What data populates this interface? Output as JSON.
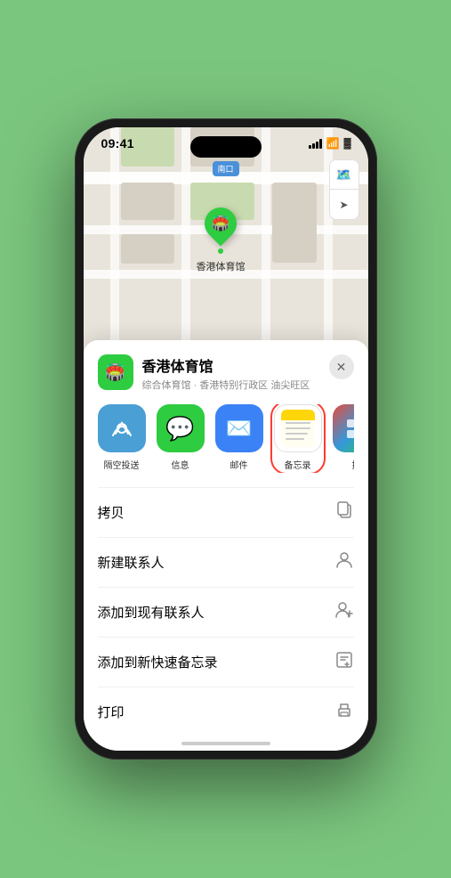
{
  "status_bar": {
    "time": "09:41",
    "time_icon": "navigation-icon"
  },
  "map": {
    "label": "南口",
    "marker_label": "香港体育馆",
    "marker_emoji": "🏟️"
  },
  "map_controls": {
    "map_btn": "🗺️",
    "location_btn": "⬆"
  },
  "bottom_sheet": {
    "place_icon": "🏟️",
    "place_name": "香港体育馆",
    "place_subtitle": "综合体育馆 · 香港特别行政区 油尖旺区",
    "close_label": "✕"
  },
  "share_items": [
    {
      "id": "airdrop",
      "label": "隔空投送",
      "icon": "📶",
      "style": "airdrop"
    },
    {
      "id": "messages",
      "label": "信息",
      "icon": "💬",
      "style": "messages"
    },
    {
      "id": "mail",
      "label": "邮件",
      "icon": "✉️",
      "style": "mail"
    },
    {
      "id": "notes",
      "label": "备忘录",
      "icon": "notes",
      "style": "notes",
      "highlighted": true
    },
    {
      "id": "more",
      "label": "提",
      "icon": "⋯",
      "style": "more"
    }
  ],
  "menu_items": [
    {
      "label": "拷贝",
      "icon": "copy"
    },
    {
      "label": "新建联系人",
      "icon": "person"
    },
    {
      "label": "添加到现有联系人",
      "icon": "person-add"
    },
    {
      "label": "添加到新快速备忘录",
      "icon": "note-add"
    },
    {
      "label": "打印",
      "icon": "print"
    }
  ]
}
